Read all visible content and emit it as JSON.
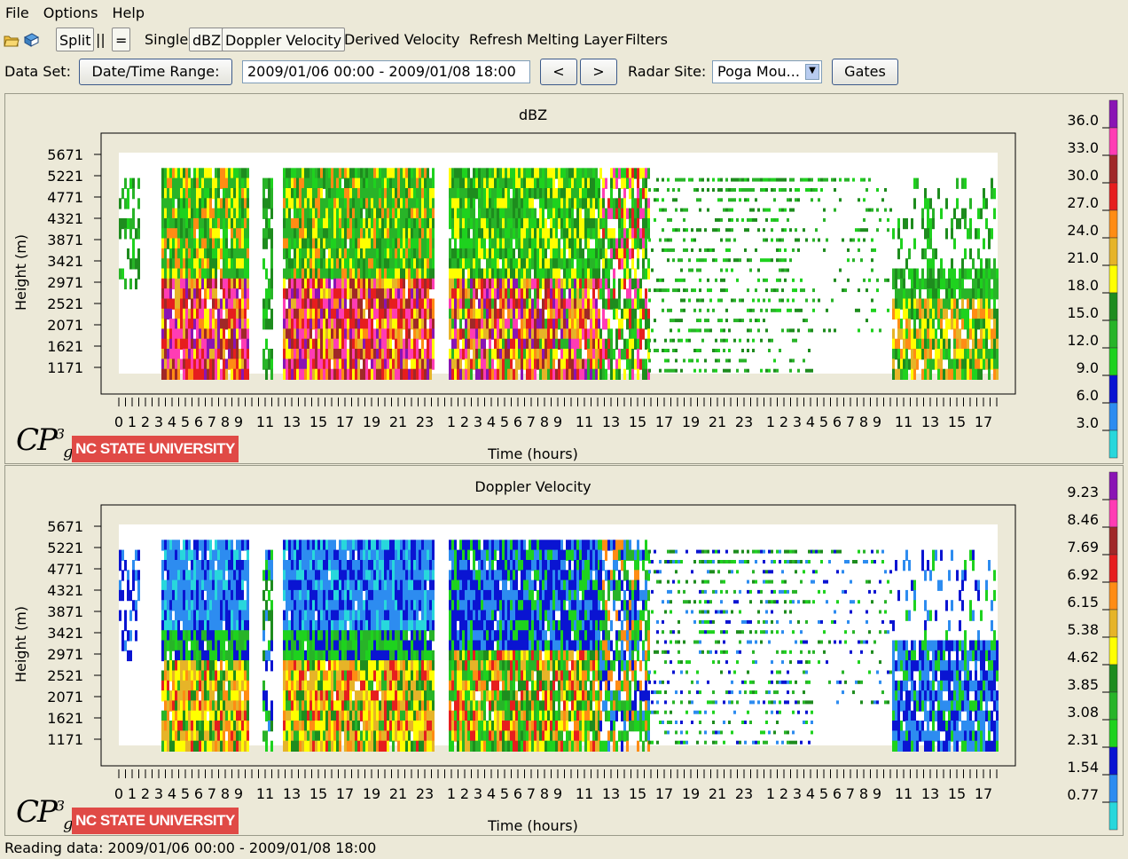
{
  "menu": [
    "File",
    "Options",
    "Help"
  ],
  "toolbar": {
    "split": "Split",
    "parallel": "||",
    "equals": "=",
    "single": "Single",
    "dbz": "dBZ",
    "doppler": "Doppler Velocity",
    "derived": "Derived Velocity",
    "refresh": "Refresh",
    "melting": "Melting Layer",
    "filters": "Filters"
  },
  "dataset": {
    "label": "Data Set:",
    "range_button": "Date/Time Range:",
    "range_value": "2009/01/06 00:00 - 2009/01/08 18:00",
    "prev": "<",
    "next": ">",
    "site_label": "Radar Site:",
    "site_value": "Poga Mou...",
    "gates": "Gates"
  },
  "branding": {
    "logo_text": "CP",
    "university": "NC STATE UNIVERSITY"
  },
  "status": "Reading data: 2009/01/06 00:00 - 2009/01/08 18:00",
  "colors": {
    "background": "#ece9d8",
    "brand_red": "#e04a46"
  },
  "chart_data": [
    {
      "type": "heatmap",
      "title": "dBZ",
      "xlabel": "Time (hours)",
      "ylabel": "Height (m)",
      "yticks": [
        1171,
        1621,
        2071,
        2521,
        2971,
        3421,
        3871,
        4321,
        4771,
        5221,
        5671
      ],
      "xticks": [
        "0",
        "1",
        "2",
        "3",
        "4",
        "5",
        "6",
        "7",
        "8",
        "9",
        "11",
        "13",
        "15",
        "17",
        "19",
        "21",
        "23",
        "1",
        "2",
        "3",
        "4",
        "5",
        "6",
        "7",
        "8",
        "9",
        "11",
        "13",
        "15",
        "17",
        "19",
        "21",
        "23",
        "1",
        "2",
        "3",
        "4",
        "5",
        "6",
        "7",
        "8",
        "9",
        "11",
        "13",
        "15",
        "17"
      ],
      "colorbar": {
        "labels": [
          "36.0",
          "33.0",
          "30.0",
          "27.0",
          "24.0",
          "21.0",
          "18.0",
          "15.0",
          "12.0",
          "9.0",
          "6.0",
          "3.0"
        ],
        "colors": [
          "#8a14b4",
          "#ff3cb4",
          "#a02828",
          "#e61e1e",
          "#ff8c14",
          "#e6b428",
          "#ffff00",
          "#1e8c1e",
          "#28b428",
          "#1ed21e",
          "#0a14d2",
          "#2d8cf0",
          "#28d7dc"
        ]
      }
    },
    {
      "type": "heatmap",
      "title": "Doppler Velocity",
      "xlabel": "Time (hours)",
      "ylabel": "Height (m)",
      "yticks": [
        1171,
        1621,
        2071,
        2521,
        2971,
        3421,
        3871,
        4321,
        4771,
        5221,
        5671
      ],
      "xticks": [
        "0",
        "1",
        "2",
        "3",
        "4",
        "5",
        "6",
        "7",
        "8",
        "9",
        "11",
        "13",
        "15",
        "17",
        "19",
        "21",
        "23",
        "1",
        "2",
        "3",
        "4",
        "5",
        "6",
        "7",
        "8",
        "9",
        "11",
        "13",
        "15",
        "17",
        "19",
        "21",
        "23",
        "1",
        "2",
        "3",
        "4",
        "5",
        "6",
        "7",
        "8",
        "9",
        "11",
        "13",
        "15",
        "17"
      ],
      "colorbar": {
        "labels": [
          "9.23",
          "8.46",
          "7.69",
          "6.92",
          "6.15",
          "5.38",
          "4.62",
          "3.85",
          "3.08",
          "2.31",
          "1.54",
          "0.77"
        ],
        "colors": [
          "#8a14b4",
          "#ff3cb4",
          "#a02828",
          "#e61e1e",
          "#ff8c14",
          "#e6b428",
          "#ffff00",
          "#1e8c1e",
          "#28b428",
          "#1ed21e",
          "#0a14d2",
          "#2d8cf0",
          "#28d7dc"
        ]
      }
    }
  ]
}
